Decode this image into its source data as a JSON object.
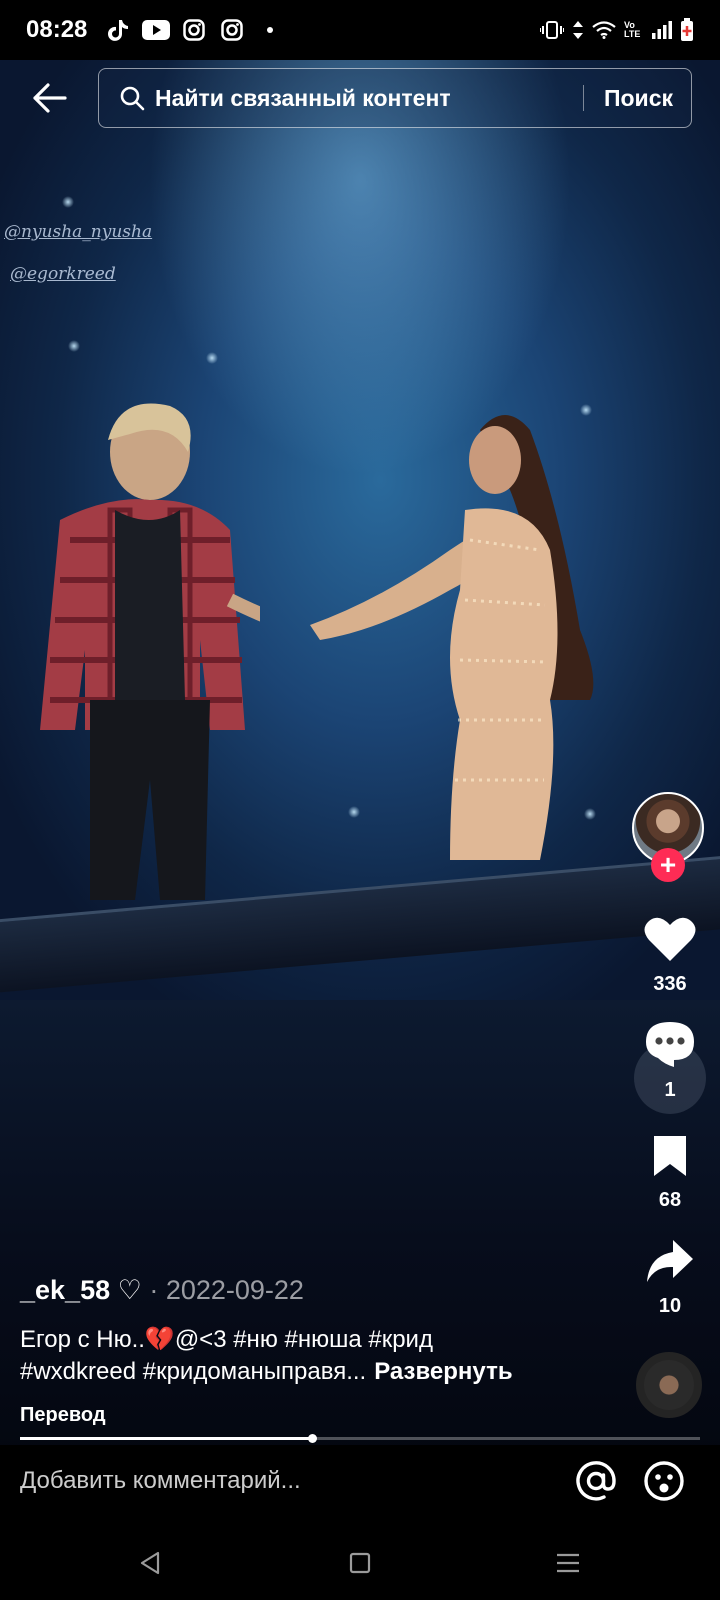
{
  "status_bar": {
    "time": "08:28",
    "left_icons": [
      "tiktok-icon",
      "youtube-icon",
      "instagram-icon",
      "instagram-icon",
      "dot-icon"
    ],
    "right_icons": [
      "vibrate-icon",
      "data-arrows-icon",
      "wifi-icon",
      "volte-icon",
      "signal-icon",
      "battery-icon"
    ],
    "volte_label": "Vo LTE"
  },
  "search": {
    "placeholder": "Найти связанный контент",
    "button_label": "Поиск"
  },
  "video": {
    "watermarks": [
      "@nyusha_nyusha",
      "@egorkreed"
    ]
  },
  "actions": {
    "likes": "336",
    "comments": "1",
    "saves": "68",
    "shares": "10"
  },
  "post": {
    "author": "_ek_58",
    "author_suffix": " ♡",
    "date": " · 2022-09-22",
    "caption_line1": "Егор с Ню..💔@<3 #ню #нюша #крид",
    "caption_line2": "#wxdkreed #кридоманыправя...",
    "expand_label": "Развернуть",
    "translate_label": "Перевод",
    "progress": 0.43
  },
  "comment_bar": {
    "placeholder": "Добавить комментарий..."
  },
  "colors": {
    "accent": "#fe2c55",
    "background": "#000000"
  }
}
